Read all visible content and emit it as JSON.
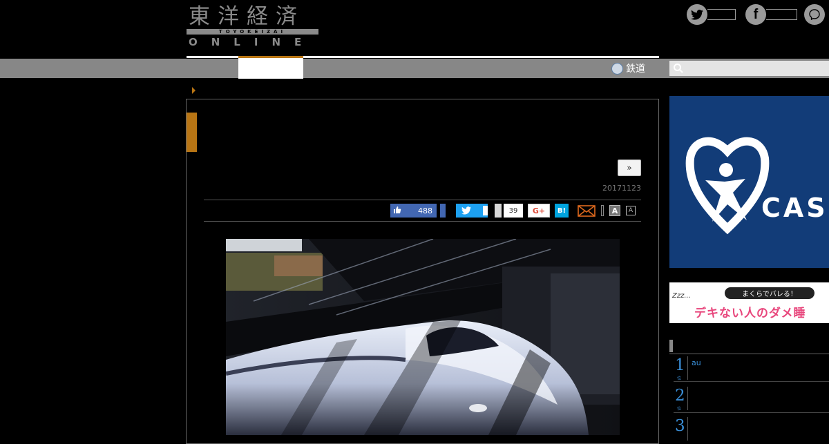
{
  "header": {
    "logo": {
      "kanji": "東洋経済",
      "roman": "TOYOKEIZAI",
      "online": "ONLINE"
    },
    "social": [
      {
        "name": "twitter",
        "icon": "twitter-icon"
      },
      {
        "name": "facebook",
        "icon": "facebook-icon"
      },
      {
        "name": "messenger",
        "icon": "messenger-icon"
      }
    ]
  },
  "nav": {
    "rail_label": "鉄道",
    "rail_icon": "train-icon",
    "search_icon": "search-icon"
  },
  "article": {
    "next_label": "»",
    "date": "20171123",
    "share": {
      "fb_like_count": "488",
      "pocket_count": "39",
      "gplus_label": "G+",
      "hatena_label": "B!",
      "font_large": "A",
      "font_small": "A"
    }
  },
  "sidebar": {
    "ad_casa_text": "CAS",
    "ad_makura_pill": "まくらでバレる！",
    "ad_makura_title": "デキない人のダメ睡",
    "ad_makura_zzz": "Zzz...",
    "ranking": [
      {
        "rank": "1",
        "text": "au"
      },
      {
        "rank": "2",
        "text": ""
      },
      {
        "rank": "3",
        "text": ""
      }
    ]
  },
  "colors": {
    "accent": "#b87514",
    "nav_bar": "#878787",
    "facebook": "#4267b2",
    "twitter": "#1da1f2",
    "hatena": "#00a4de",
    "ranking_blue": "#3a8fd8",
    "casa_ad": "#123c78"
  }
}
